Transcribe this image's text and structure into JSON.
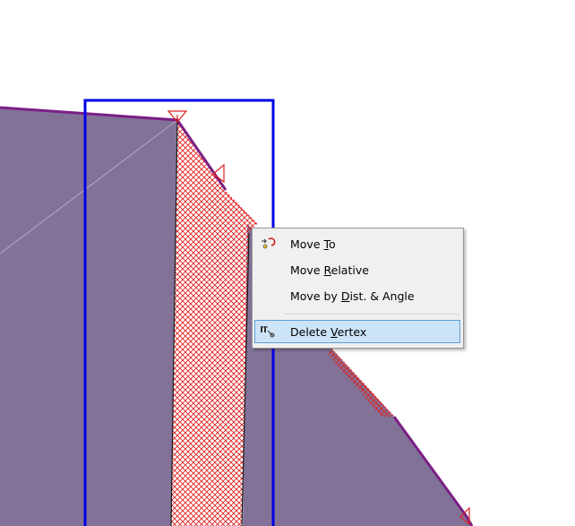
{
  "colors": {
    "fill": "#827298",
    "edge": "#7a1f85",
    "box": "#0000e6",
    "hatch": "#e02020",
    "menu_bg": "#f0f0f0",
    "menu_highlight": "#cce4f7"
  },
  "context_menu": {
    "items": [
      {
        "pre": "Move ",
        "accel": "T",
        "post": "o",
        "icon": "move-to-icon"
      },
      {
        "pre": "Move ",
        "accel": "R",
        "post": "elative",
        "icon": ""
      },
      {
        "pre": "Move by ",
        "accel": "D",
        "post": "ist. & Angle",
        "icon": ""
      },
      {
        "pre": "Delete ",
        "accel": "V",
        "post": "ertex",
        "icon": "delete-vertex-icon",
        "selected": true
      }
    ]
  }
}
